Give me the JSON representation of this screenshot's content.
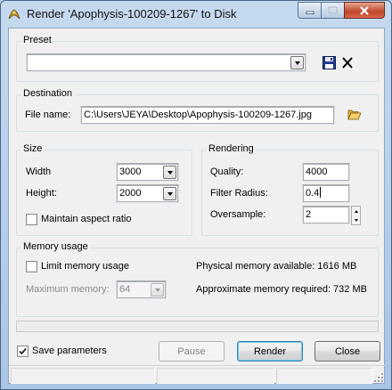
{
  "window": {
    "title": "Render 'Apophysis-100209-1267' to Disk",
    "icon": "apophysis-fractal-icon",
    "controls": [
      "minimize-icon",
      "maximize-icon",
      "close-icon"
    ]
  },
  "preset": {
    "group_label": "Preset",
    "value": "",
    "save_icon": "floppy-disk-icon",
    "delete_icon": "x-delete-icon"
  },
  "destination": {
    "group_label": "Destination",
    "file_label": "File name:",
    "file_value": "C:\\Users\\JEYA\\Desktop\\Apophysis-100209-1267.jpg",
    "browse_icon": "open-folder-icon"
  },
  "size": {
    "group_label": "Size",
    "width_label": "Width",
    "width_value": "3000",
    "height_label": "Height:",
    "height_value": "2000",
    "aspect_label": "Maintain aspect ratio",
    "aspect_checked": false
  },
  "rendering": {
    "group_label": "Rendering",
    "quality_label": "Quality:",
    "quality_value": "4000",
    "filter_label": "Filter Radius:",
    "filter_value": "0.4",
    "oversample_label": "Oversample:",
    "oversample_value": "2"
  },
  "memory": {
    "group_label": "Memory usage",
    "limit_label": "Limit memory usage",
    "limit_checked": false,
    "max_label": "Maximum memory:",
    "max_value": "64",
    "physical_text": "Physical memory available: 1616 MB",
    "required_text": "Approximate memory required: 732 MB"
  },
  "footer": {
    "save_params_label": "Save parameters",
    "save_params_checked": true,
    "pause_label": "Pause",
    "render_label": "Render",
    "close_label": "Close"
  },
  "colors": {
    "frame": "#b9d1ea",
    "client": "#f0f0f0",
    "close_button": "#c0462b",
    "default_button_border": "#3c7fb1"
  }
}
